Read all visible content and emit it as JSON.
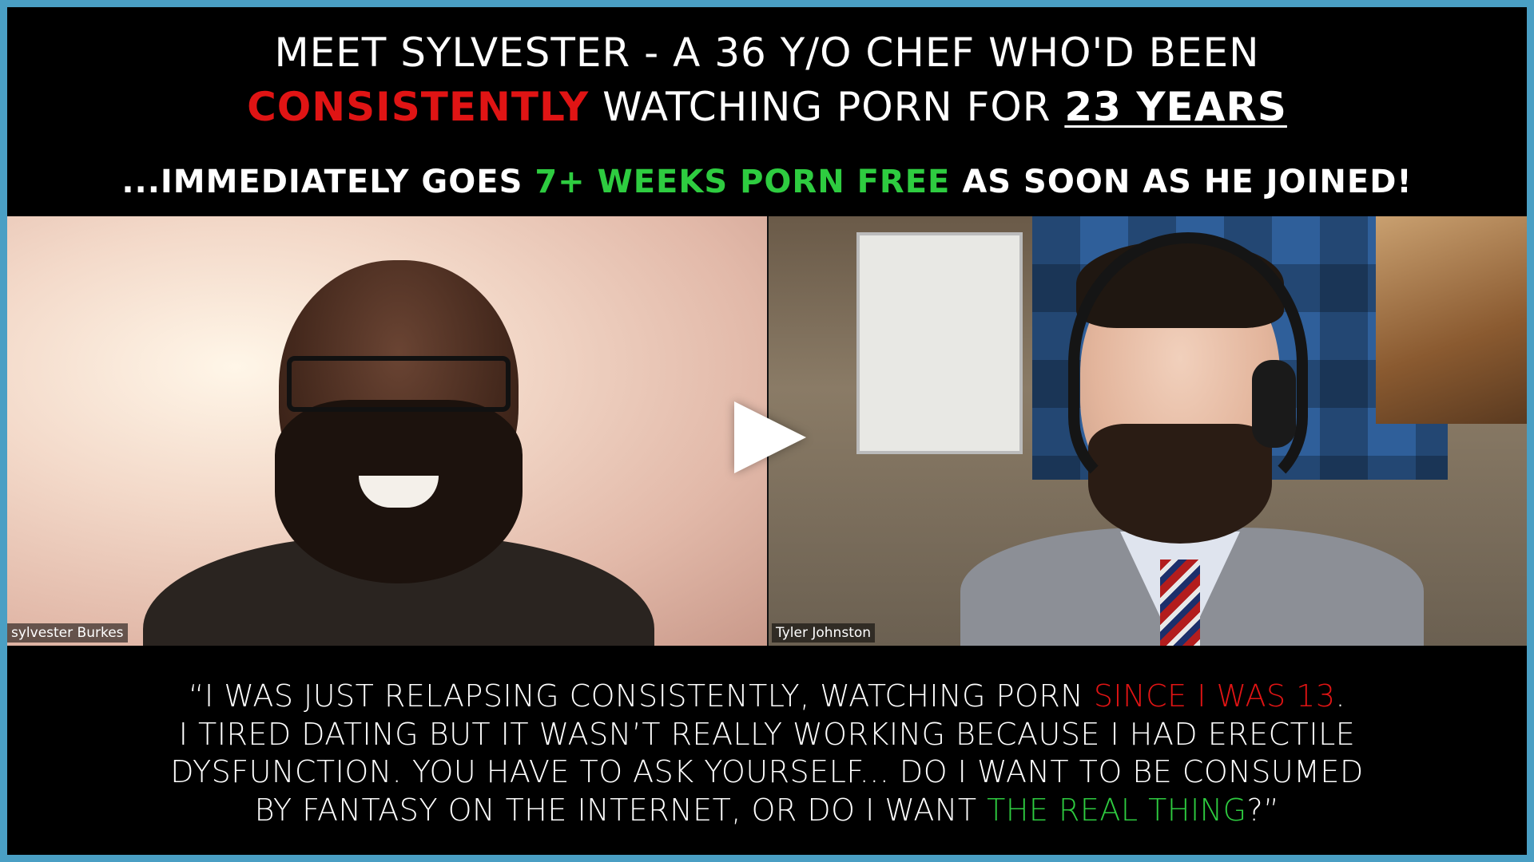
{
  "headline": {
    "line1": "MEET SYLVESTER - A 36 Y/O CHEF WHO'D BEEN",
    "line2_red": "CONSISTENTLY",
    "line2_mid": " WATCHING PORN FOR ",
    "line2_underlined": "23 YEARS",
    "line3_pre": "...IMMEDIATELY GOES ",
    "line3_green": "7+ WEEKS PORN FREE",
    "line3_post": " AS SOON AS HE JOINED!"
  },
  "video": {
    "participant_left": "sylvester Burkes",
    "participant_right": "Tyler Johnston",
    "play_icon": "play-icon"
  },
  "quote": {
    "l1_pre": "“I WAS JUST RELAPSING CONSISTENTLY, WATCHING PORN ",
    "l1_red": "SINCE I WAS 13",
    "l1_post": ".",
    "l2": "I TIRED DATING BUT IT WASN’T REALLY WORKING BECAUSE I HAD ERECTILE",
    "l3": "DYSFUNCTION. YOU HAVE TO ASK YOURSELF... DO I WANT TO BE CONSUMED",
    "l4_pre": "BY FANTASY ON THE INTERNET, OR DO I WANT ",
    "l4_green": "THE REAL THING",
    "l4_post": "?”"
  },
  "colors": {
    "border": "#4a9fc4",
    "accent_red": "#e01414",
    "accent_green": "#2ecc40"
  }
}
